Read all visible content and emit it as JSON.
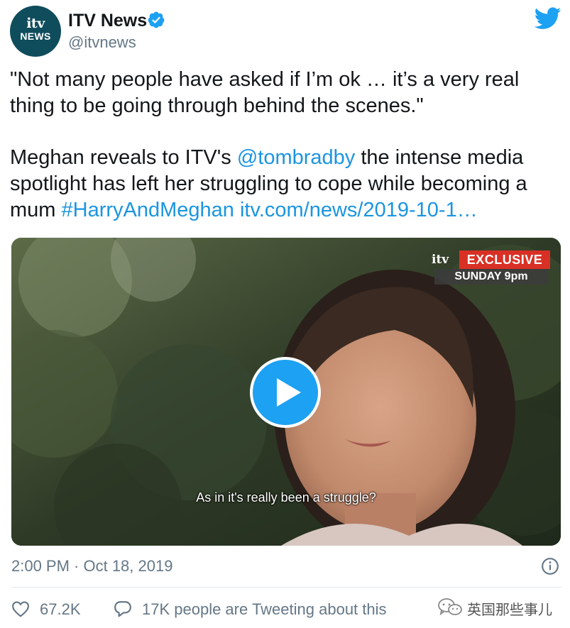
{
  "account": {
    "avatar_logo": "itv",
    "avatar_sub": "NEWS",
    "name": "ITV News",
    "handle": "@itvnews",
    "verified": true
  },
  "tweet": {
    "quote": "\"Not many people have asked if I’m ok … it’s a very real thing to be going through behind the scenes.\"",
    "body_pre": "Meghan reveals to ITV's ",
    "mention": "@tombradby",
    "body_mid": " the intense media spotlight has left her struggling to cope while becoming a mum ",
    "hashtag": "#HarryAndMeghan",
    "url": "itv.com/news/2019-10-1…"
  },
  "video": {
    "badge_brand": "itv",
    "badge_label": "EXCLUSIVE",
    "badge_schedule": "SUNDAY 9pm",
    "subtitle": "As in it's really been a struggle?"
  },
  "meta": {
    "timestamp": "2:00 PM · Oct 18, 2019",
    "likes": "67.2K",
    "tweeting": "17K people are Tweeting about this"
  },
  "watermark": {
    "text": "英国那些事儿"
  },
  "icons": {
    "verified": "verified-badge-icon",
    "bird": "twitter-bird-icon",
    "play": "play-icon",
    "info": "info-icon",
    "like": "heart-icon",
    "reply": "reply-bubble-icon",
    "wechat": "wechat-icon"
  },
  "colors": {
    "accent": "#1da1f2",
    "link": "#1b95e0",
    "muted": "#657786",
    "exclusive": "#d93025"
  }
}
